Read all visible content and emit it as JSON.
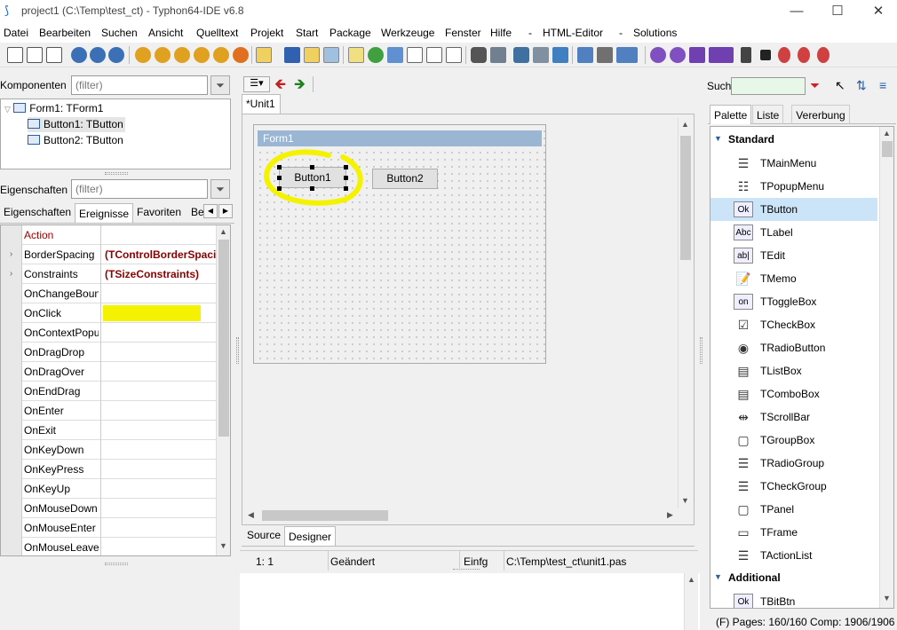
{
  "window": {
    "title": "project1 (C:\\Temp\\test_ct) - Typhon64-IDE v6.8",
    "controls": {
      "minimize": "—",
      "maximize": "☐",
      "close": "✕"
    }
  },
  "menu": [
    "Datei",
    "Bearbeiten",
    "Suchen",
    "Ansicht",
    "Quelltext",
    "Projekt",
    "Start",
    "Package",
    "Werkzeuge",
    "Fenster",
    "Hilfe",
    "-",
    "HTML-Editor",
    "-",
    "Solutions"
  ],
  "components_panel": {
    "label": "Komponenten",
    "filter_placeholder": "(filter)",
    "tree": [
      {
        "label": "Form1: TForm1",
        "level": 0
      },
      {
        "label": "Button1: TButton",
        "level": 1,
        "selected": true
      },
      {
        "label": "Button2: TButton",
        "level": 1
      }
    ]
  },
  "properties_panel": {
    "label": "Eigenschaften",
    "filter_placeholder": "(filter)",
    "tabs": [
      "Eigenschaften",
      "Ereignisse",
      "Favoriten",
      "Be"
    ],
    "active_tab": "Ereignisse",
    "rows": [
      {
        "name": "Action",
        "value": "",
        "expandable": false,
        "highlight": true
      },
      {
        "name": "BorderSpacing",
        "value": "(TControlBorderSpacing)",
        "expandable": true
      },
      {
        "name": "Constraints",
        "value": "(TSizeConstraints)",
        "expandable": true
      },
      {
        "name": "OnChangeBounds",
        "value": "",
        "expandable": false
      },
      {
        "name": "OnClick",
        "value": "",
        "expandable": false
      },
      {
        "name": "OnContextPopup",
        "value": "",
        "expandable": false
      },
      {
        "name": "OnDragDrop",
        "value": "",
        "expandable": false
      },
      {
        "name": "OnDragOver",
        "value": "",
        "expandable": false
      },
      {
        "name": "OnEndDrag",
        "value": "",
        "expandable": false
      },
      {
        "name": "OnEnter",
        "value": "",
        "expandable": false
      },
      {
        "name": "OnExit",
        "value": "",
        "expandable": false
      },
      {
        "name": "OnKeyDown",
        "value": "",
        "expandable": false
      },
      {
        "name": "OnKeyPress",
        "value": "",
        "expandable": false
      },
      {
        "name": "OnKeyUp",
        "value": "",
        "expandable": false
      },
      {
        "name": "OnMouseDown",
        "value": "",
        "expandable": false
      },
      {
        "name": "OnMouseEnter",
        "value": "",
        "expandable": false
      },
      {
        "name": "OnMouseLeave",
        "value": "",
        "expandable": false
      }
    ]
  },
  "editor": {
    "tab": "*Unit1",
    "form_caption": "Form1",
    "button1": "Button1",
    "button2": "Button2",
    "bottom_tabs": [
      "Source",
      "Designer"
    ],
    "active_bottom_tab": "Designer",
    "status": {
      "pos": "1:   1",
      "modified": "Geändert",
      "mode": "Einfg",
      "file": "C:\\Temp\\test_ct\\unit1.pas"
    }
  },
  "palette_panel": {
    "search_label": "Such",
    "tabs": [
      "Palette",
      "Liste",
      "Vererbung"
    ],
    "active_tab": "Palette",
    "categories": [
      {
        "name": "Standard",
        "items": [
          "TMainMenu",
          "TPopupMenu",
          "TButton",
          "TLabel",
          "TEdit",
          "TMemo",
          "TToggleBox",
          "TCheckBox",
          "TRadioButton",
          "TListBox",
          "TComboBox",
          "TScrollBar",
          "TGroupBox",
          "TRadioGroup",
          "TCheckGroup",
          "TPanel",
          "TFrame",
          "TActionList"
        ]
      },
      {
        "name": "Additional",
        "items": [
          "TBitBtn"
        ]
      }
    ],
    "selected_item": "TButton",
    "icons": {
      "TButton": "Ok",
      "TLabel": "Abc",
      "TEdit": "ab|",
      "TToggleBox": "on",
      "TBitBtn": "Ok"
    },
    "status": "(F) Pages: 160/160  Comp: 1906/1906"
  },
  "colors": {
    "highlight": "#f5f200",
    "selection": "#cce4f7",
    "prop_value": "#8b0000",
    "action": "#a00000"
  }
}
